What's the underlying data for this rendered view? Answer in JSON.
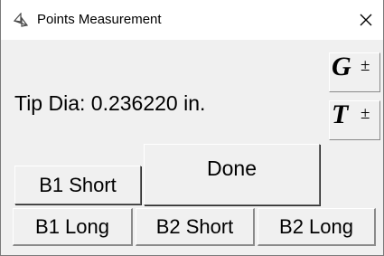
{
  "window": {
    "title": "Points Measurement",
    "title_icon": "points-measure-icon",
    "close_icon": "close-icon"
  },
  "main": {
    "tip_label": "Tip Dia: 0.236220 in."
  },
  "gdt_buttons": {
    "g_letter": "G",
    "t_letter": "T",
    "plus_minus": "±"
  },
  "buttons": {
    "b1_short": "B1 Short",
    "done": "Done",
    "b1_long": "B1 Long",
    "b2_short": "B2 Short",
    "b2_long": "B2 Long"
  }
}
